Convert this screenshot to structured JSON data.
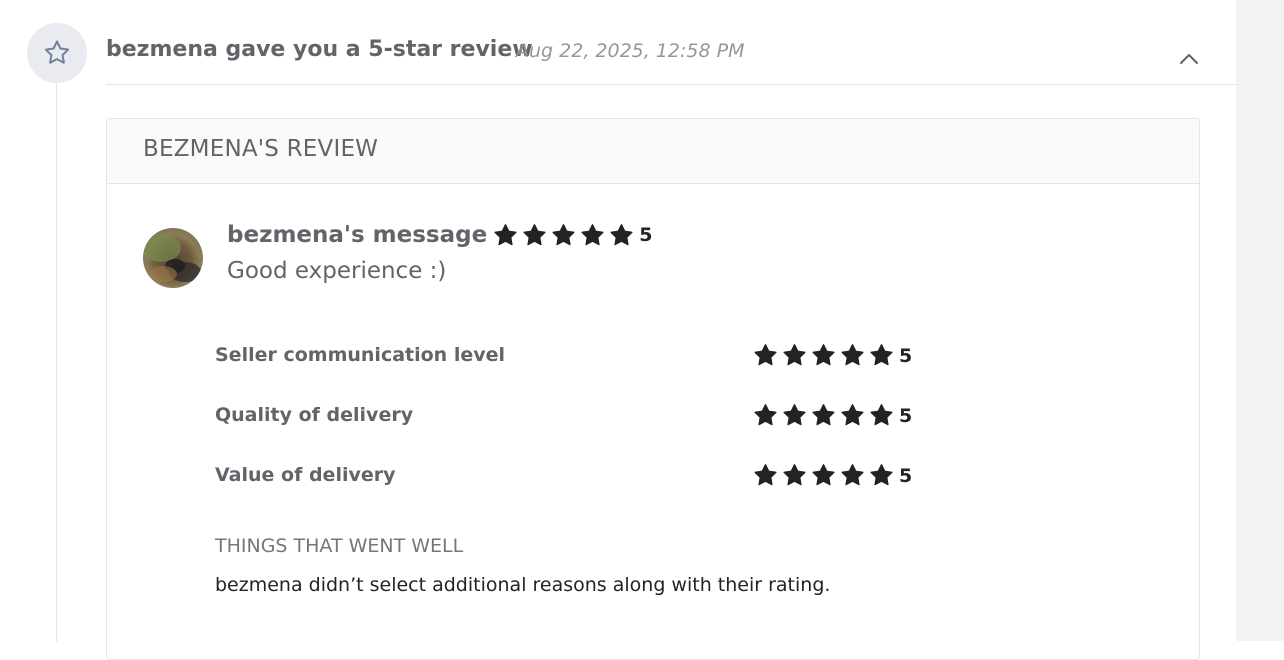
{
  "event": {
    "icon": "star-outline-icon",
    "title": "bezmena gave you a 5-star review",
    "timestamp": "Aug 22, 2025, 12:58 PM",
    "toggle_icon": "chevron-up-icon"
  },
  "review": {
    "card_title": "BEZMENA'S REVIEW",
    "author_message_label": "bezmena's message",
    "overall_rating": "5",
    "message": "Good experience :)",
    "criteria": [
      {
        "label": "Seller communication level",
        "rating": "5"
      },
      {
        "label": "Quality of delivery",
        "rating": "5"
      },
      {
        "label": "Value of delivery",
        "rating": "5"
      }
    ],
    "things_went_well_title": "THINGS THAT WENT WELL",
    "things_went_well_text": "bezmena didn’t select additional reasons along with their rating."
  },
  "colors": {
    "star": "#222325",
    "icon_circle": "#e9ebf0",
    "icon_stroke": "#74819a"
  }
}
